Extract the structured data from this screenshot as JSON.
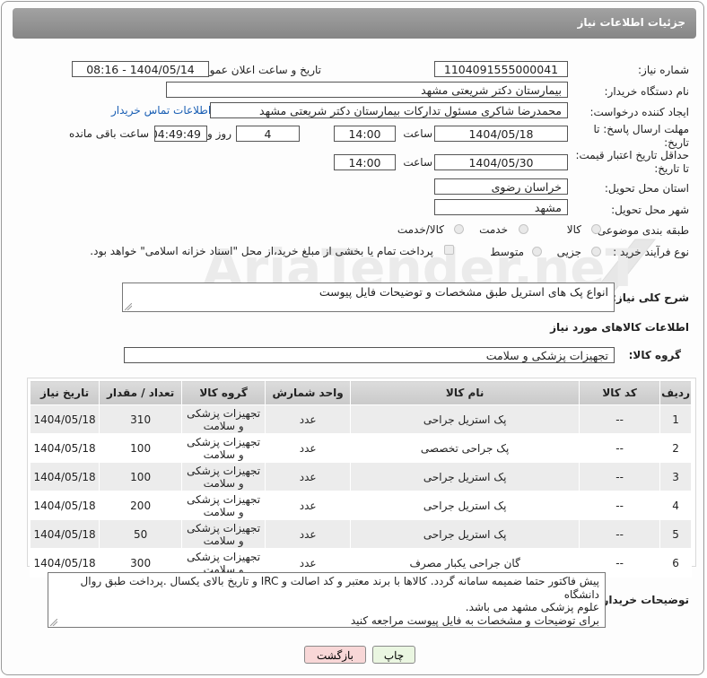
{
  "header": {
    "title": "جزئیات اطلاعات نیاز"
  },
  "form": {
    "need_number_label": "شماره نیاز:",
    "need_number": "1104091555000041",
    "announce_label": "تاریخ و ساعت اعلان عمومی:",
    "announce_value": "1404/05/14 - 08:16",
    "buyer_org_label": "نام دستگاه خریدار:",
    "buyer_org": "بیمارستان دکتر شریعتی مشهد",
    "creator_label": "ایجاد کننده درخواست:",
    "creator": "محمدرضا شاکری مسئول تدارکات بیمارستان دکتر شریعتی مشهد",
    "contact_link": "اطلاعات تماس خریدار",
    "deadline_label": "مهلت ارسال پاسخ: تا تاریخ:",
    "deadline_date": "1404/05/18",
    "time_label": "ساعت",
    "deadline_time": "14:00",
    "days_value": "4",
    "days_label": "روز و",
    "remaining_time": "04:49:49",
    "remaining_label": "ساعت باقی مانده",
    "validity_label": "حداقل تاریخ اعتبار قیمت: تا تاریخ:",
    "validity_date": "1404/05/30",
    "validity_time": "14:00",
    "province_label": "استان محل تحویل:",
    "province": "خراسان رضوی",
    "city_label": "شهر محل تحویل:",
    "city": "مشهد",
    "category_label": "طبقه بندی موضوعی:",
    "category_options": [
      "کالا",
      "خدمت",
      "کالا/خدمت"
    ],
    "process_label": "نوع فرآیند خرید :",
    "process_options": [
      "جزیی",
      "متوسط"
    ],
    "payment_note": "پرداخت تمام یا بخشی از مبلغ خرید،از محل \"اسناد خزانه اسلامی\" خواهد بود.",
    "description_label": "شرح کلی نیاز:",
    "description": "انواع پک های استریل طبق مشخصات و توضیحات فایل پیوست",
    "goods_info_title": "اطلاعات کالاهای مورد نیاز",
    "goods_group_label": "گروه کالا:",
    "goods_group": "تجهیزات پزشکی و سلامت"
  },
  "table": {
    "headers": [
      "ردیف",
      "کد کالا",
      "نام کالا",
      "واحد شمارش",
      "گروه کالا",
      "تعداد / مقدار",
      "تاریخ نیاز"
    ],
    "rows": [
      [
        "1",
        "--",
        "پک استریل جراحی",
        "عدد",
        "تجهیزات پزشکی و سلامت",
        "310",
        "1404/05/18"
      ],
      [
        "2",
        "--",
        "پک جراحی تخصصی",
        "عدد",
        "تجهیزات پزشکی و سلامت",
        "100",
        "1404/05/18"
      ],
      [
        "3",
        "--",
        "پک استریل جراحی",
        "عدد",
        "تجهیزات پزشکی و سلامت",
        "100",
        "1404/05/18"
      ],
      [
        "4",
        "--",
        "پک استریل جراحی",
        "عدد",
        "تجهیزات پزشکی و سلامت",
        "200",
        "1404/05/18"
      ],
      [
        "5",
        "--",
        "پک استریل جراحی",
        "عدد",
        "تجهیزات پزشکی و سلامت",
        "50",
        "1404/05/18"
      ],
      [
        "6",
        "--",
        "گان جراحی یکبار مصرف",
        "عدد",
        "تجهیزات پزشکی و سلامت",
        "300",
        "1404/05/18"
      ]
    ]
  },
  "buyer_notes": {
    "label": "توضیحات خریدار:",
    "line1": "پیش فاکتور حتما ضمیمه سامانه گردد. کالاها با برند معتبر و کد اصالت و IRC و تاریخ بالای یکسال .پرداخت طبق روال دانشگاه",
    "line2": "علوم پزشکی مشهد می باشد.",
    "line3": "برای توضیحات و مشخصات به فایل پیوست مراجعه کنید"
  },
  "buttons": {
    "print": "چاپ",
    "back": "بازگشت"
  },
  "watermark": "AriaTender.neT",
  "colors": {
    "header_bg": "#8f8f8f",
    "link": "#1a5fb4",
    "back_button": "#f8d7d7",
    "print_button": "#eaf6e1"
  }
}
